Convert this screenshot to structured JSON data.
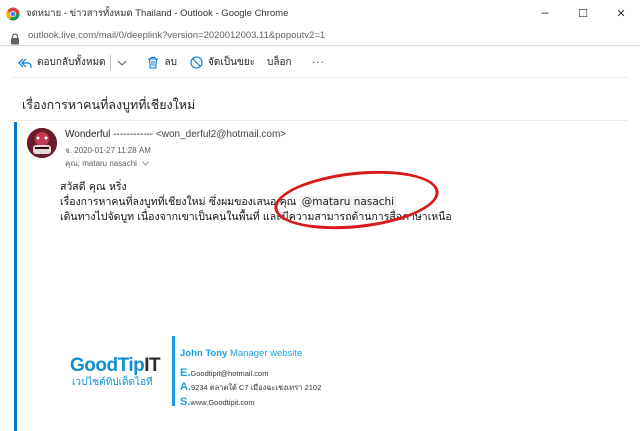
{
  "window": {
    "title": "จดหมาย - ข่าวสารทั้งหมด Thailand - Outlook - Google Chrome",
    "controls": [
      "─",
      "☐",
      "✕"
    ]
  },
  "address_bar": {
    "url": "outlook.live.com/mail/0/deeplink?version=2020012003.11&popoutv2=1"
  },
  "toolbar": {
    "reply_all_label": "ตอบกลับทั้งหมด",
    "delete_label": "ลบ",
    "junk_label": "จัดเป็นขยะ",
    "block_label": "บล็อก",
    "more_label": "···"
  },
  "message": {
    "subject": "เรื่องการหาคนที่ลงบูทที่เชียงใหม่",
    "sender_name": "Wonderful ------------",
    "sender_email": "<won_derful2@hotmail.com>",
    "date": "จ. 2020-01-27 11:28 AM",
    "to_label": "คุณ;",
    "to_name": "mataru nasachi",
    "body_line1": "สวัสดี คุณ หริ่ง",
    "body_line2_prefix": "เรื่องการหาคนที่ลงบูทที่เชียงใหม่ ซึ่งผมของเสนอ คุณ ",
    "mention": "@mataru nasachi",
    "body_line3": "เดินทางไปจัดบูท เนื่องจากเขาเป็นคนในพื้นที่ และมีความสามารถด้านการสื่อภาษาเหนือ"
  },
  "signature": {
    "logo_main": "GoodTip",
    "logo_accent": "IT",
    "logo_tagline": "เวปไซต์ทิปเด็ดไอที",
    "name": "John Tony",
    "role": "Manager website",
    "email_letter": "E.",
    "email": "Goodtipit@hotmail.com",
    "address_letter": "A.",
    "address": "9234 ตลาดใต้ C7 เมืองฉะเชงเทรา 2102",
    "site_letter": "S.",
    "site": "www.Goodtipit.com"
  },
  "colors": {
    "accent": "#0078d4",
    "highlight": "#d9191c",
    "signature_blue": "#1a9de0"
  }
}
